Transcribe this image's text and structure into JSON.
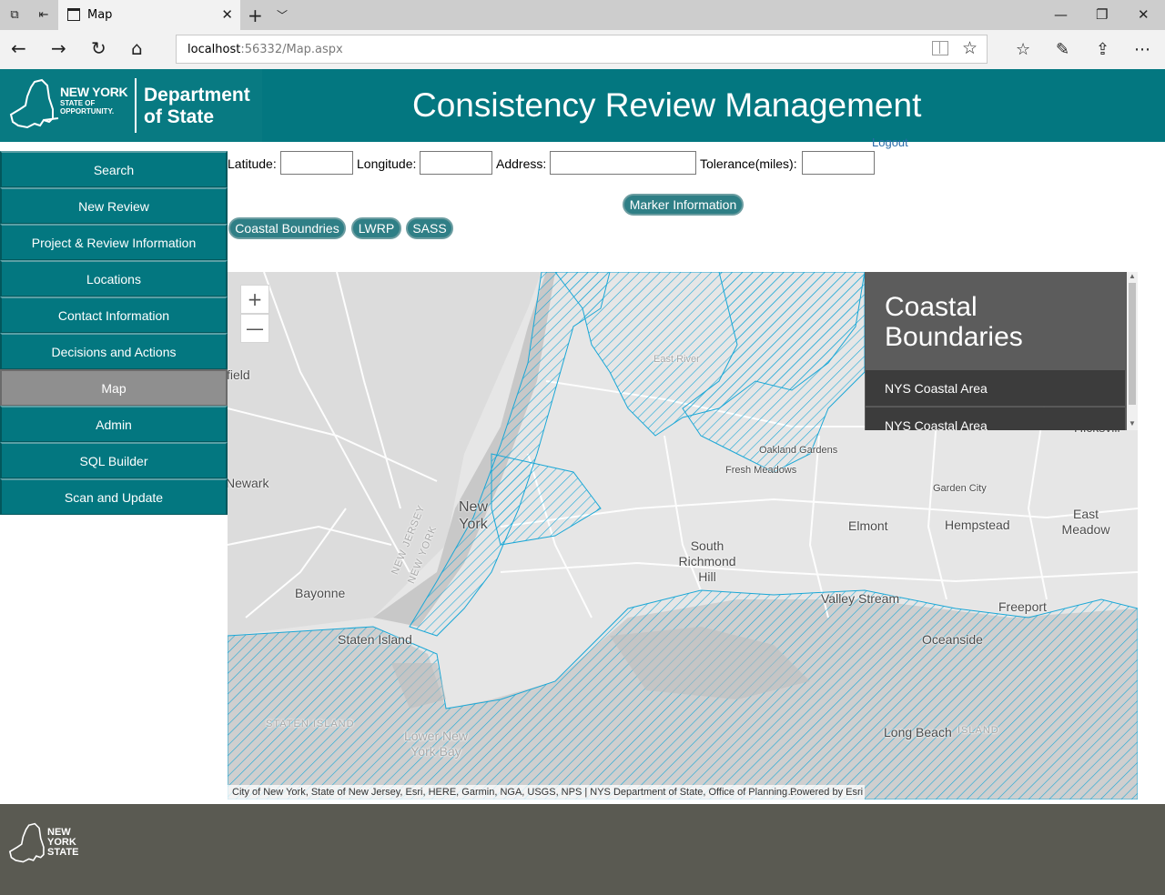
{
  "browser": {
    "tab_title": "Map",
    "new_tab_symbol": "+",
    "tab_close_symbol": "✕",
    "url_host": "localhost",
    "url_path": ":56332/Map.aspx",
    "icons": [
      "tab-preview-icon",
      "set-aside-tabs-icon",
      "page-icon",
      "back-icon",
      "forward-icon",
      "refresh-icon",
      "home-icon",
      "reading-view-icon",
      "favorite-icon",
      "favorites-hub-icon",
      "pen-icon",
      "share-icon",
      "more-icon"
    ]
  },
  "header": {
    "ny_line1": "NEW YORK",
    "ny_line2": "STATE OF",
    "ny_line3": "OPPORTUNITY.",
    "dept_line1": "Department",
    "dept_line2": "of State",
    "title": "Consistency Review Management",
    "color": "#037780"
  },
  "sidebar": {
    "items": [
      {
        "label": "Search"
      },
      {
        "label": "New Review"
      },
      {
        "label": "Project & Review Information"
      },
      {
        "label": "Locations"
      },
      {
        "label": "Contact Information"
      },
      {
        "label": "Decisions and Actions"
      },
      {
        "label": "Map",
        "active": true
      },
      {
        "label": "Admin"
      },
      {
        "label": "SQL Builder"
      },
      {
        "label": "Scan and Update"
      }
    ]
  },
  "form": {
    "logout": "Logout",
    "latitude_label": "Latitude:",
    "longitude_label": "Longitude:",
    "address_label": "Address:",
    "tolerance_label": "Tolerance(miles):",
    "latitude_value": "",
    "longitude_value": "",
    "address_value": "",
    "tolerance_value": ""
  },
  "buttons": {
    "marker_info": "Marker Information",
    "coastal": "Coastal Boundries",
    "lwrp": "LWRP",
    "sass": "SASS"
  },
  "map": {
    "zoom_in": "+",
    "zoom_out": "—",
    "places": {
      "east_river": "East River",
      "oakland_gardens": "Oakland Gardens",
      "fresh_meadows": "Fresh Meadows",
      "garden_city": "Garden City",
      "east_meadow": "East Meadow",
      "hempstead": "Hempstead",
      "elmont": "Elmont",
      "south_richmond_hill": "South Richmond Hill",
      "new_york": "New York",
      "newark": "Newark",
      "field": "field",
      "bayonne": "Bayonne",
      "staten_island": "Staten Island",
      "staten_island_caps": "STATEN ISLAND",
      "lower_ny_bay": "Lower New York Bay",
      "valley_stream": "Valley Stream",
      "freeport": "Freeport",
      "oceanside": "Oceanside",
      "long_beach": "Long Beach",
      "island": "ISLAND",
      "hicksville": "Hicksvill",
      "nj_label": "NEW JERSEY",
      "ny_label": "NEW YORK"
    },
    "attribution": "City of New York, State of New Jersey, Esri, HERE, Garmin, NGA, USGS, NPS | NYS Department of State, Office of Planning…",
    "powered_by": "Powered by",
    "esri": "Esri",
    "legend": {
      "title_line1": "Coastal",
      "title_line2": "Boundaries",
      "items": [
        "NYS Coastal Area",
        "NYS Coastal Area"
      ]
    },
    "hatch_color": "#1aa7d6"
  },
  "footer": {
    "line1": "NEW",
    "line2": "YORK",
    "line3": "STATE"
  }
}
